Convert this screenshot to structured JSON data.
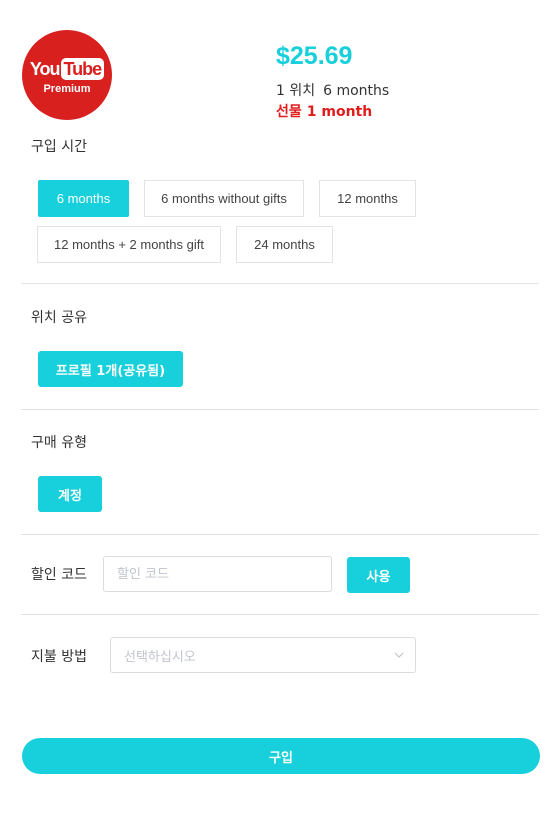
{
  "product": {
    "logo_word_you": "You",
    "logo_word_tube": "Tube",
    "logo_sub": "Premium",
    "price": "$25.69",
    "slots": "1 위치",
    "duration": "6 months",
    "gift_label": "선물",
    "gift_value": "1 month",
    "price_color": "#17d0db",
    "gift_color": "#e21b1b",
    "brand_color": "#d8201f"
  },
  "purchase_time": {
    "label": "구입 시간",
    "options": [
      "6 months",
      "6 months without gifts",
      "12 months",
      "12 months + 2 months gift",
      "24 months"
    ],
    "selected": "6 months"
  },
  "location_share": {
    "label": "위치 공유",
    "option": "프로필 1개(공유됨)"
  },
  "purchase_type": {
    "label": "구매 유형",
    "option": "계정"
  },
  "discount": {
    "label": "할인 코드",
    "placeholder": "할인 코드",
    "apply_label": "사용"
  },
  "payment": {
    "label": "지불 방법",
    "placeholder": "선택하십시오"
  },
  "buy_label": "구입",
  "accent_color": "#17d0db"
}
